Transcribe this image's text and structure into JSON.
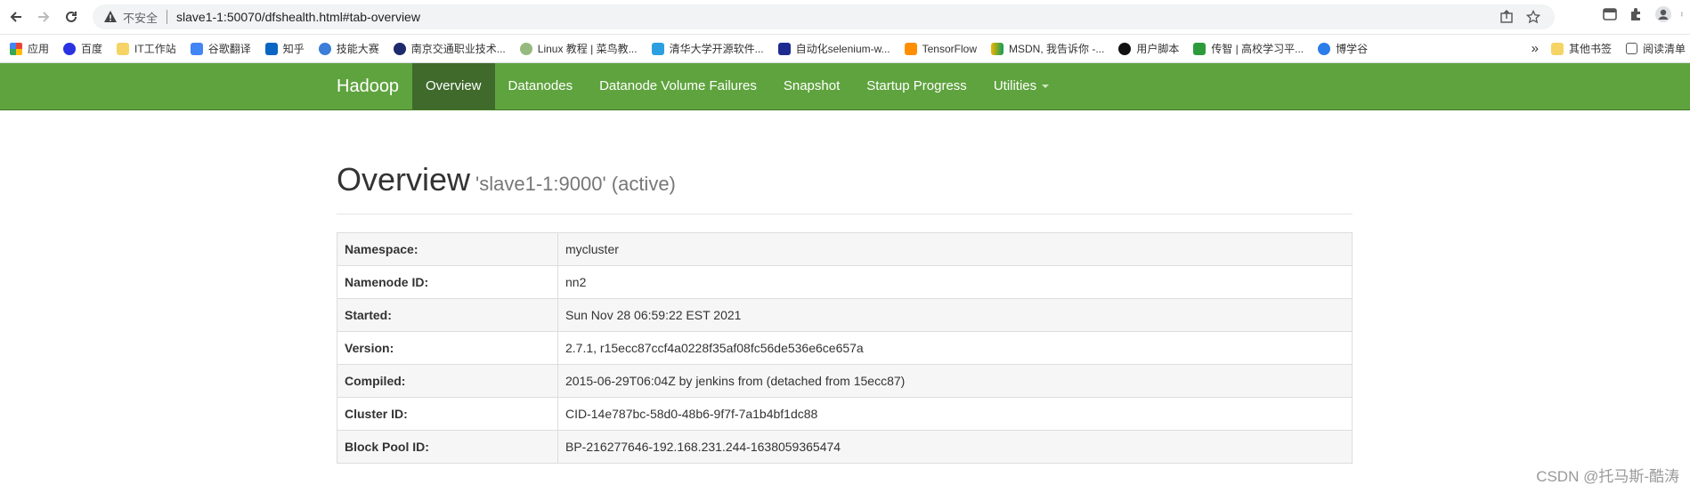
{
  "browser": {
    "security_label": "不安全",
    "url": "slave1-1:50070/dfshealth.html#tab-overview"
  },
  "bookmarks": {
    "items": [
      {
        "label": "应用",
        "icon": "apps-grid-icon"
      },
      {
        "label": "百度",
        "icon": "baidu-icon"
      },
      {
        "label": "IT工作站",
        "icon": "folder-icon"
      },
      {
        "label": "谷歌翻译",
        "icon": "translate-icon"
      },
      {
        "label": "知乎",
        "icon": "zhihu-icon"
      },
      {
        "label": "技能大赛",
        "icon": "site-icon"
      },
      {
        "label": "南京交通职业技术...",
        "icon": "site-icon"
      },
      {
        "label": "Linux 教程 | 菜鸟教...",
        "icon": "runoob-icon"
      },
      {
        "label": "清华大学开源软件...",
        "icon": "tuna-icon"
      },
      {
        "label": "自动化selenium-w...",
        "icon": "w-icon"
      },
      {
        "label": "TensorFlow",
        "icon": "tensorflow-icon"
      },
      {
        "label": "MSDN, 我告诉你 -...",
        "icon": "msdn-icon"
      },
      {
        "label": "用户脚本",
        "icon": "userscript-icon"
      },
      {
        "label": "传智 | 高校学习平...",
        "icon": "chuanzhi-icon"
      },
      {
        "label": "博学谷",
        "icon": "boxuegu-icon"
      }
    ],
    "more": "»",
    "other_bookmarks": "其他书签",
    "reading_list": "阅读清单"
  },
  "navbar": {
    "brand": "Hadoop",
    "items": [
      {
        "label": "Overview",
        "active": true
      },
      {
        "label": "Datanodes"
      },
      {
        "label": "Datanode Volume Failures"
      },
      {
        "label": "Snapshot"
      },
      {
        "label": "Startup Progress"
      },
      {
        "label": "Utilities",
        "dropdown": true
      }
    ]
  },
  "overview": {
    "title": "Overview",
    "subtitle": "'slave1-1:9000' (active)",
    "rows": [
      {
        "key": "Namespace:",
        "value": "mycluster"
      },
      {
        "key": "Namenode ID:",
        "value": "nn2"
      },
      {
        "key": "Started:",
        "value": "Sun Nov 28 06:59:22 EST 2021"
      },
      {
        "key": "Version:",
        "value": "2.7.1, r15ecc87ccf4a0228f35af08fc56de536e6ce657a"
      },
      {
        "key": "Compiled:",
        "value": "2015-06-29T06:04Z by jenkins from (detached from 15ecc87)"
      },
      {
        "key": "Cluster ID:",
        "value": "CID-14e787bc-58d0-48b6-9f7f-7a1b4bf1dc88"
      },
      {
        "key": "Block Pool ID:",
        "value": "BP-216277646-192.168.231.244-1638059365474"
      }
    ]
  },
  "watermark": "CSDN @托马斯-酷涛",
  "colors": {
    "navbar_bg": "#5fa33e",
    "navbar_active": "#3f6a2c"
  }
}
